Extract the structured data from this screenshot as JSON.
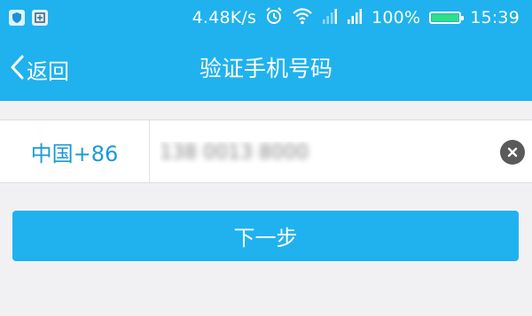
{
  "status_bar": {
    "network_speed": "4.48K/s",
    "battery_percent": "100%",
    "battery_level": 1.0,
    "time": "15:39",
    "icons": [
      "shield-icon",
      "notification-icon",
      "alarm-icon",
      "wifi-icon",
      "signal-icon",
      "signal-icon",
      "battery-icon"
    ]
  },
  "nav": {
    "back_label": "返回",
    "title": "验证手机号码"
  },
  "phone": {
    "country_code": "中国+86",
    "value": "138 0013 8000",
    "value_obscured": true
  },
  "actions": {
    "next_label": "下一步"
  },
  "colors": {
    "header": "#1fb2ee",
    "button": "#1fb2ee",
    "country_code_text": "#1a9ad8",
    "background": "#f1f1f3",
    "battery_fill": "#2ee083"
  }
}
